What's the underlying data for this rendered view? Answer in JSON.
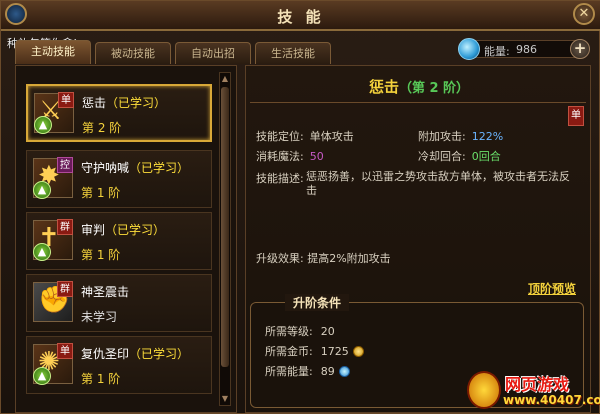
{
  "title": "技 能",
  "gift_text": "种礼包等你拿!",
  "tabs": [
    {
      "label": "主动技能",
      "active": true
    },
    {
      "label": "被动技能",
      "active": false
    },
    {
      "label": "自动出招",
      "active": false
    },
    {
      "label": "生活技能",
      "active": false
    }
  ],
  "energy": {
    "label": "能量:",
    "value": "986",
    "plus": "+"
  },
  "skills": [
    {
      "name": "惩击",
      "status": "（已学习）",
      "level": "第 2 阶",
      "badge": "单",
      "icon": "sword-icon",
      "selected": true
    },
    {
      "name": "守护呐喊",
      "status": "（已学习）",
      "level": "第 1 阶",
      "badge": "控",
      "icon": "shout-icon",
      "selected": false
    },
    {
      "name": "审判",
      "status": "（已学习）",
      "level": "第 1 阶",
      "badge": "群",
      "icon": "judgment-icon",
      "selected": false
    },
    {
      "name": "神圣震击",
      "status": "",
      "level": "未学习",
      "badge": "群",
      "icon": "holy-shock-icon",
      "selected": false
    },
    {
      "name": "复仇圣印",
      "status": "（已学习）",
      "level": "第 1 阶",
      "badge": "单",
      "icon": "vengeance-seal-icon",
      "selected": false
    }
  ],
  "detail": {
    "name": "惩击",
    "rank": "（第 2 阶）",
    "badge": "单",
    "positioning_label": "技能定位:",
    "positioning_value": "单体攻击",
    "extra_attack_label": "附加攻击:",
    "extra_attack_value": "122%",
    "mana_label": "消耗魔法:",
    "mana_value": "50",
    "cooldown_label": "冷却回合:",
    "cooldown_value": "0回合",
    "desc_label": "技能描述:",
    "desc_text": "惩恶扬善，以迅雷之势攻击敌方单体，被攻击者无法反击",
    "upgrade_effect": "升级效果: 提高2%附加攻击",
    "preview_link": "顶阶预览"
  },
  "requirements": {
    "title": "升阶条件",
    "level_label": "所需等级:",
    "level_value": "20",
    "gold_label": "所需金币:",
    "gold_value": "1725",
    "energy_label": "所需能量:",
    "energy_value": "89"
  },
  "watermark": {
    "top": "网页游戏",
    "url": "www.40407.com"
  },
  "colors": {
    "accent_gold": "#f4d23c",
    "learned_yellow": "#ffdf3a",
    "rank_green": "#58c858",
    "attack_blue": "#6ab4ff",
    "mana_purple": "#c65ac6"
  }
}
